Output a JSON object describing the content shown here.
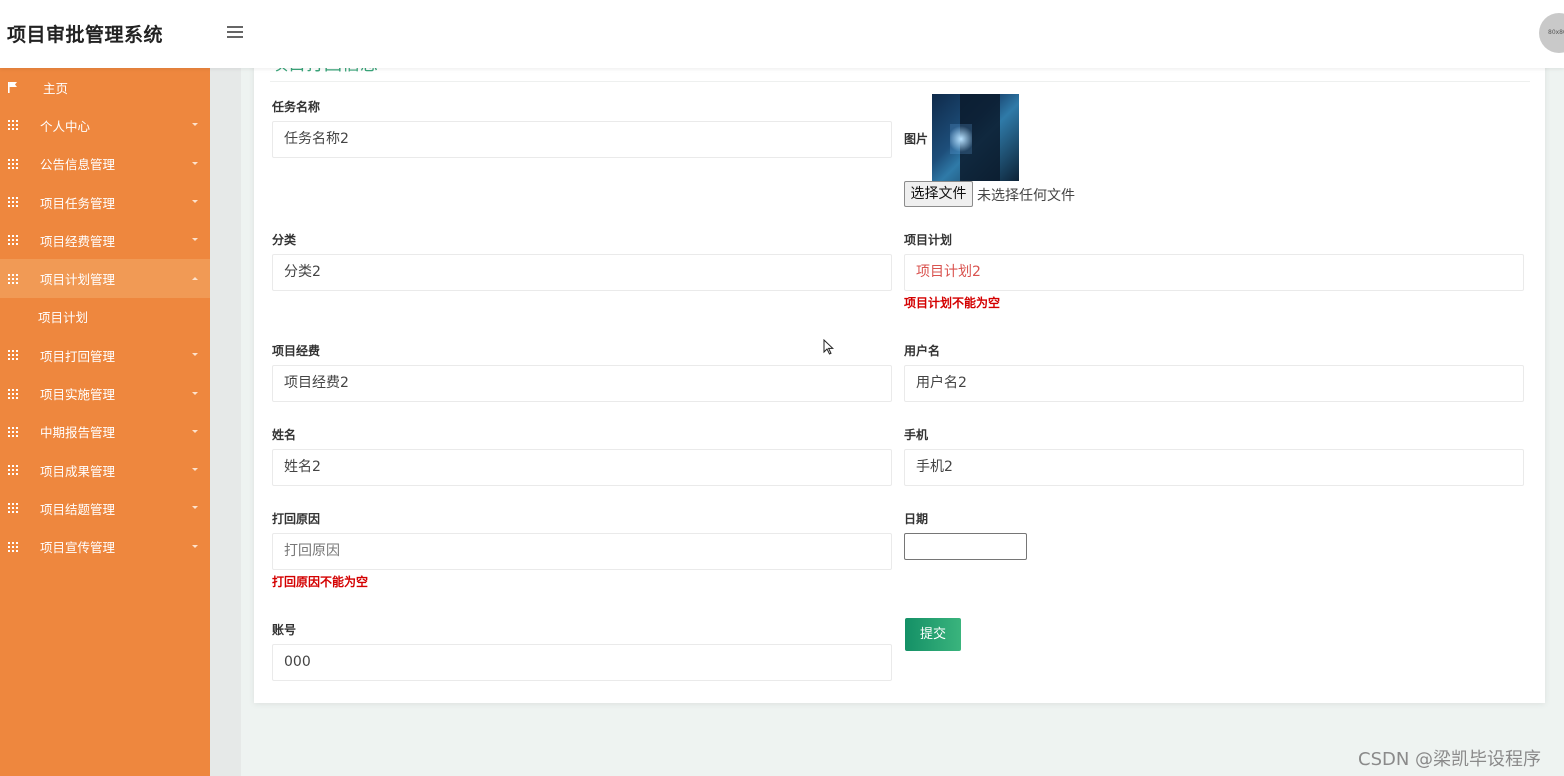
{
  "app": {
    "title": "项目审批管理系统"
  },
  "header": {
    "avatar_text": "80x80"
  },
  "sidebar": {
    "home": "主页",
    "items": [
      {
        "label": "个人中心"
      },
      {
        "label": "公告信息管理"
      },
      {
        "label": "项目任务管理"
      },
      {
        "label": "项目经费管理"
      },
      {
        "label": "项目计划管理"
      },
      {
        "label": "项目打回管理"
      },
      {
        "label": "项目实施管理"
      },
      {
        "label": "中期报告管理"
      },
      {
        "label": "项目成果管理"
      },
      {
        "label": "项目结题管理"
      },
      {
        "label": "项目宣传管理"
      }
    ],
    "active_sub": "项目计划"
  },
  "card": {
    "title": "项目打回信息"
  },
  "form": {
    "task_name": {
      "label": "任务名称",
      "value": "任务名称2"
    },
    "image": {
      "label": "图片",
      "button": "选择文件",
      "status": "未选择任何文件"
    },
    "category": {
      "label": "分类",
      "value": "分类2"
    },
    "plan": {
      "label": "项目计划",
      "value": "项目计划2",
      "error": "项目计划不能为空"
    },
    "funding": {
      "label": "项目经费",
      "value": "项目经费2"
    },
    "username": {
      "label": "用户名",
      "value": "用户名2"
    },
    "name": {
      "label": "姓名",
      "value": "姓名2"
    },
    "phone": {
      "label": "手机",
      "value": "手机2"
    },
    "reason": {
      "label": "打回原因",
      "placeholder": "打回原因",
      "error": "打回原因不能为空"
    },
    "date": {
      "label": "日期"
    },
    "account": {
      "label": "账号",
      "value": "000"
    },
    "submit": "提交"
  },
  "watermark": "CSDN @梁凯毕设程序"
}
